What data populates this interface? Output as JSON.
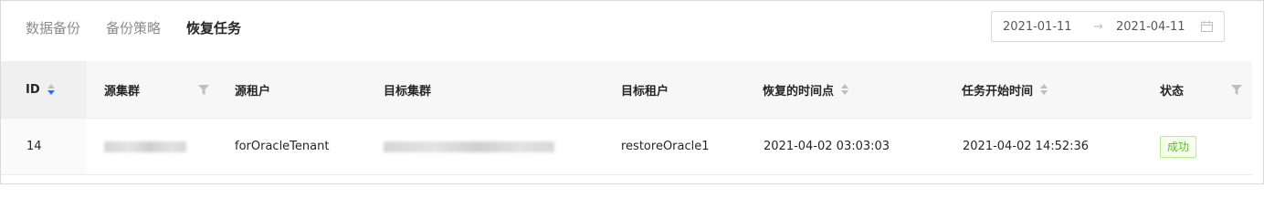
{
  "tabs": [
    {
      "label": "数据备份",
      "active": false
    },
    {
      "label": "备份策略",
      "active": false
    },
    {
      "label": "恢复任务",
      "active": true
    }
  ],
  "date_range": {
    "start": "2021-01-11",
    "separator": "→",
    "end": "2021-04-11",
    "icon": "calendar-icon"
  },
  "table": {
    "columns": [
      {
        "label": "ID",
        "sortable": true,
        "sort": "descend"
      },
      {
        "label": "源集群",
        "filterable": true
      },
      {
        "label": "源租户"
      },
      {
        "label": "目标集群"
      },
      {
        "label": "目标租户"
      },
      {
        "label": "恢复的时间点",
        "sortable": true
      },
      {
        "label": "任务开始时间",
        "sortable": true
      },
      {
        "label": "状态",
        "filterable": true
      }
    ],
    "rows": [
      {
        "id": "14",
        "source_cluster": "",
        "source_tenant": "forOracleTenant",
        "target_cluster": "",
        "target_tenant": "restoreOracle1",
        "restore_point": "2021-04-02 03:03:03",
        "start_time": "2021-04-02 14:52:36",
        "status": "成功"
      }
    ]
  },
  "colors": {
    "accent": "#1677ff",
    "success": "#52c41a",
    "header_bg": "#f7f7f7",
    "border": "#d9d9d9"
  }
}
